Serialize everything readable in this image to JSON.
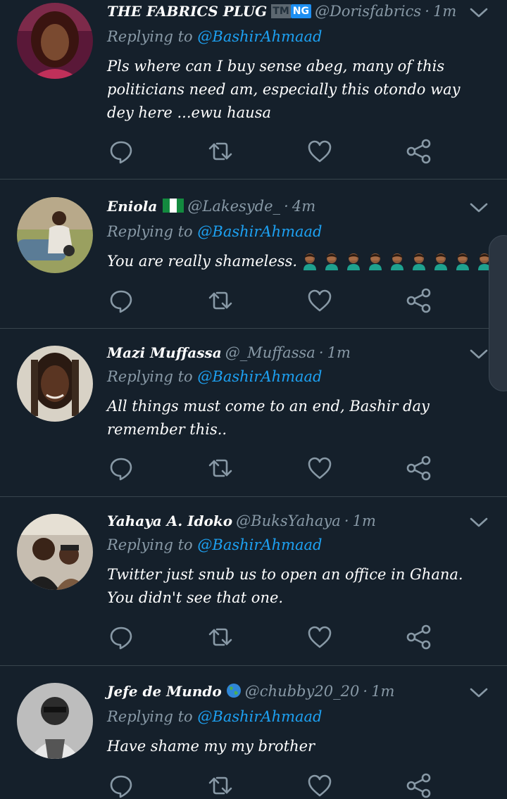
{
  "colors": {
    "background": "#15202b",
    "divider": "#38444d",
    "name": "#ffffff",
    "secondary": "#8899a6",
    "mention": "#1da1f2"
  },
  "reply_prefix": "Replying to",
  "tweets": [
    {
      "name": "THE FABRICS PLUG",
      "badges": [
        "TM",
        "NG"
      ],
      "handle": "@Dorisfabrics",
      "dot": "·",
      "time": "1m",
      "mention": "@BashirAhmaad",
      "text": "Pls where can I buy sense abeg, many of this politicians need am, especially this otondo way dey here ...ewu hausa",
      "actions": [
        "reply-icon",
        "retweet-icon",
        "like-icon",
        "share-icon"
      ]
    },
    {
      "name": "Eniola",
      "flag": "nigeria-flag-icon",
      "handle": "@Lakesyde_",
      "dot": "·",
      "time": "4m",
      "mention": "@BashirAhmaad",
      "text": "You are really shameless.",
      "emoji": "man-facepalming-icon",
      "emoji_count": 9,
      "actions": [
        "reply-icon",
        "retweet-icon",
        "like-icon",
        "share-icon"
      ]
    },
    {
      "name": "Mazi Muffassa",
      "handle": "@_Muffassa",
      "dot": "·",
      "time": "1m",
      "mention": "@BashirAhmaad",
      "text": "All things must come to an end, Bashir day remember this..",
      "actions": [
        "reply-icon",
        "retweet-icon",
        "like-icon",
        "share-icon"
      ]
    },
    {
      "name": "Yahaya A. Idoko",
      "handle": "@BuksYahaya",
      "dot": "·",
      "time": "1m",
      "mention": "@BashirAhmaad",
      "text": "Twitter just snub us to open an office in Ghana. You didn't see that one.",
      "actions": [
        "reply-icon",
        "retweet-icon",
        "like-icon",
        "share-icon"
      ]
    },
    {
      "name": "Jefe de Mundo",
      "globe": "globe-icon",
      "handle": "@chubby20_20",
      "dot": "·",
      "time": "1m",
      "mention": "@BashirAhmaad",
      "text": "Have shame my my brother",
      "actions": [
        "reply-icon",
        "retweet-icon",
        "like-icon",
        "share-icon"
      ]
    }
  ]
}
